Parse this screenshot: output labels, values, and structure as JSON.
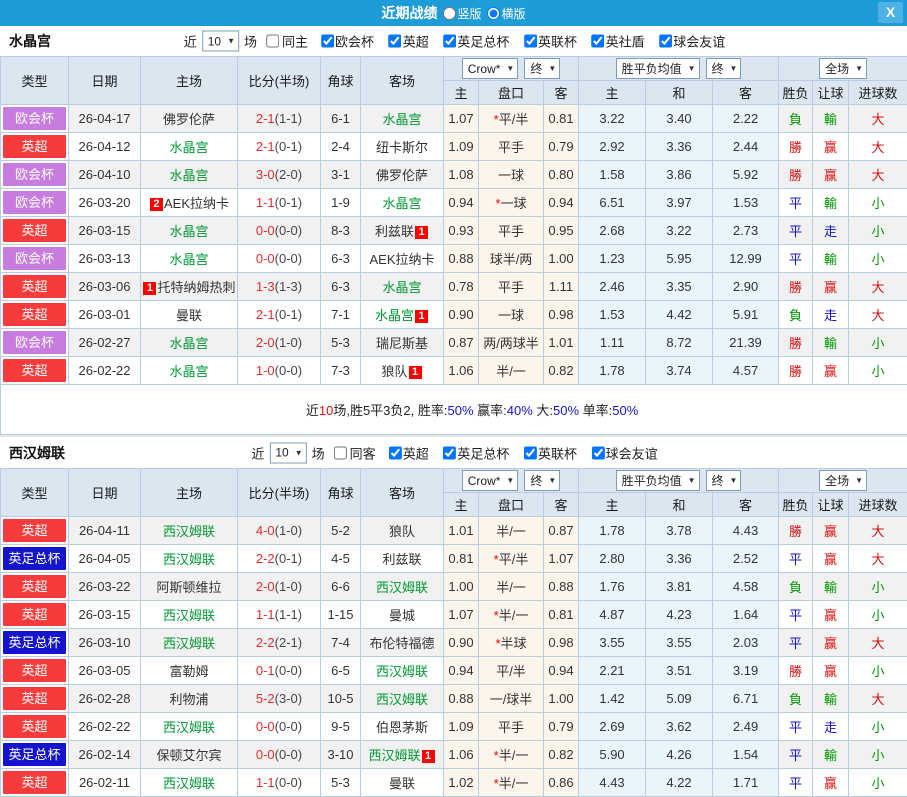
{
  "titlebar": {
    "title": "近期战绩",
    "radios": [
      {
        "label": "竖版",
        "checked": false
      },
      {
        "label": "横版",
        "checked": true
      }
    ],
    "close_label": "X",
    "bar_color": "#1e9cd7"
  },
  "table_header": {
    "type": "类型",
    "date": "日期",
    "home": "主场",
    "score": "比分(半场)",
    "corner": "角球",
    "away": "客场",
    "odds_source_dd": "Crow*",
    "odds_final_dd": "终",
    "avg_dd": "胜平负均值",
    "avg_final_dd": "终",
    "scope_dd": "全场",
    "ah_home": "主",
    "ah_handicap": "盘口",
    "ah_away": "客",
    "eu_home": "主",
    "eu_draw": "和",
    "eu_away": "客",
    "wdl": "胜负",
    "handicap_result": "让球",
    "goals": "进球数"
  },
  "colors": {
    "league_red": "#f53b3b",
    "league_purple": "#c77ce0",
    "league_blue": "#1414cf",
    "win_red": "#dd1111",
    "draw_blue": "#1111cc",
    "lose_green": "#009900",
    "team_green": "#009933"
  },
  "sections": [
    {
      "team": "水晶宫",
      "near_label": "近",
      "count": "10",
      "count_arrow": "▼",
      "matches_label": "场",
      "same": {
        "label": "同主",
        "checked": false
      },
      "comps": [
        {
          "label": "欧会杯",
          "checked": true
        },
        {
          "label": "英超",
          "checked": true
        },
        {
          "label": "英足总杯",
          "checked": true
        },
        {
          "label": "英联杯",
          "checked": true
        },
        {
          "label": "英社盾",
          "checked": true
        },
        {
          "label": "球会友谊",
          "checked": true
        }
      ],
      "rows": [
        {
          "type": "欧会杯",
          "tc": "purple",
          "date": "26-04-17",
          "hb": "",
          "home": "佛罗伦萨",
          "hg": "0",
          "ft": "2-1",
          "ht": "(1-1)",
          "corner": "6-1",
          "away": "水晶宫",
          "ag": "1",
          "ab": "",
          "h": "1.07",
          "star": "*",
          "hcap": "平/半",
          "a": "0.81",
          "o1": "3.22",
          "o2": "3.40",
          "o3": "2.22",
          "wdl": "負",
          "wdlc": "g",
          "let": "輸",
          "letc": "g",
          "ou": "大",
          "ouc": "r"
        },
        {
          "type": "英超",
          "tc": "red",
          "date": "26-04-12",
          "hb": "",
          "home": "水晶宫",
          "hg": "1",
          "ft": "2-1",
          "ht": "(0-1)",
          "corner": "2-4",
          "away": "纽卡斯尔",
          "ag": "0",
          "ab": "",
          "h": "1.09",
          "star": "",
          "hcap": "平手",
          "a": "0.79",
          "o1": "2.92",
          "o2": "3.36",
          "o3": "2.44",
          "wdl": "勝",
          "wdlc": "r",
          "let": "赢",
          "letc": "r",
          "ou": "大",
          "ouc": "r"
        },
        {
          "type": "欧会杯",
          "tc": "purple",
          "date": "26-04-10",
          "hb": "",
          "home": "水晶宫",
          "hg": "1",
          "ft": "3-0",
          "ht": "(2-0)",
          "corner": "3-1",
          "away": "佛罗伦萨",
          "ag": "0",
          "ab": "",
          "h": "1.08",
          "star": "",
          "hcap": "一球",
          "a": "0.80",
          "o1": "1.58",
          "o2": "3.86",
          "o3": "5.92",
          "wdl": "勝",
          "wdlc": "r",
          "let": "赢",
          "letc": "r",
          "ou": "大",
          "ouc": "r"
        },
        {
          "type": "欧会杯",
          "tc": "purple",
          "date": "26-03-20",
          "hb": "2",
          "home": "AEK拉纳卡",
          "hg": "0",
          "ft": "1-1",
          "ht": "(0-1)",
          "corner": "1-9",
          "away": "水晶宫",
          "ag": "1",
          "ab": "",
          "h": "0.94",
          "star": "*",
          "hcap": "一球",
          "a": "0.94",
          "o1": "6.51",
          "o2": "3.97",
          "o3": "1.53",
          "wdl": "平",
          "wdlc": "b",
          "let": "輸",
          "letc": "g",
          "ou": "小",
          "ouc": "g"
        },
        {
          "type": "英超",
          "tc": "red",
          "date": "26-03-15",
          "hb": "",
          "home": "水晶宫",
          "hg": "1",
          "ft": "0-0",
          "ht": "(0-0)",
          "corner": "8-3",
          "away": "利兹联",
          "ag": "0",
          "ab": "1",
          "h": "0.93",
          "star": "",
          "hcap": "平手",
          "a": "0.95",
          "o1": "2.68",
          "o2": "3.22",
          "o3": "2.73",
          "wdl": "平",
          "wdlc": "b",
          "let": "走",
          "letc": "b",
          "ou": "小",
          "ouc": "g"
        },
        {
          "type": "欧会杯",
          "tc": "purple",
          "date": "26-03-13",
          "hb": "",
          "home": "水晶宫",
          "hg": "1",
          "ft": "0-0",
          "ht": "(0-0)",
          "corner": "6-3",
          "away": "AEK拉纳卡",
          "ag": "0",
          "ab": "",
          "h": "0.88",
          "star": "",
          "hcap": "球半/两",
          "a": "1.00",
          "o1": "1.23",
          "o2": "5.95",
          "o3": "12.99",
          "wdl": "平",
          "wdlc": "b",
          "let": "輸",
          "letc": "g",
          "ou": "小",
          "ouc": "g"
        },
        {
          "type": "英超",
          "tc": "red",
          "date": "26-03-06",
          "hb": "1",
          "home": "托特纳姆热刺",
          "hg": "0",
          "ft": "1-3",
          "ht": "(1-3)",
          "corner": "6-3",
          "away": "水晶宫",
          "ag": "1",
          "ab": "",
          "h": "0.78",
          "star": "",
          "hcap": "平手",
          "a": "1.11",
          "o1": "2.46",
          "o2": "3.35",
          "o3": "2.90",
          "wdl": "勝",
          "wdlc": "r",
          "let": "赢",
          "letc": "r",
          "ou": "大",
          "ouc": "r"
        },
        {
          "type": "英超",
          "tc": "red",
          "date": "26-03-01",
          "hb": "",
          "home": "曼联",
          "hg": "0",
          "ft": "2-1",
          "ht": "(0-1)",
          "corner": "7-1",
          "away": "水晶宫",
          "ag": "1",
          "ab": "1",
          "h": "0.90",
          "star": "",
          "hcap": "一球",
          "a": "0.98",
          "o1": "1.53",
          "o2": "4.42",
          "o3": "5.91",
          "wdl": "負",
          "wdlc": "g",
          "let": "走",
          "letc": "b",
          "ou": "大",
          "ouc": "r"
        },
        {
          "type": "欧会杯",
          "tc": "purple",
          "date": "26-02-27",
          "hb": "",
          "home": "水晶宫",
          "hg": "1",
          "ft": "2-0",
          "ht": "(1-0)",
          "corner": "5-3",
          "away": "瑞尼斯基",
          "ag": "0",
          "ab": "",
          "h": "0.87",
          "star": "",
          "hcap": "两/两球半",
          "a": "1.01",
          "o1": "1.11",
          "o2": "8.72",
          "o3": "21.39",
          "wdl": "勝",
          "wdlc": "r",
          "let": "輸",
          "letc": "g",
          "ou": "小",
          "ouc": "g"
        },
        {
          "type": "英超",
          "tc": "red",
          "date": "26-02-22",
          "hb": "",
          "home": "水晶宫",
          "hg": "1",
          "ft": "1-0",
          "ht": "(0-0)",
          "corner": "7-3",
          "away": "狼队",
          "ag": "0",
          "ab": "1",
          "h": "1.06",
          "star": "",
          "hcap": "半/一",
          "a": "0.82",
          "o1": "1.78",
          "o2": "3.74",
          "o3": "4.57",
          "wdl": "勝",
          "wdlc": "r",
          "let": "赢",
          "letc": "r",
          "ou": "小",
          "ouc": "g"
        }
      ],
      "summary": [
        {
          "t": "近",
          "c": "k"
        },
        {
          "t": "10",
          "c": "r"
        },
        {
          "t": "场,胜5平3负2, 胜率:",
          "c": "k"
        },
        {
          "t": "50%",
          "c": "b"
        },
        {
          "t": " 赢率:",
          "c": "k"
        },
        {
          "t": "40%",
          "c": "b"
        },
        {
          "t": " 大:",
          "c": "k"
        },
        {
          "t": "50%",
          "c": "b"
        },
        {
          "t": " 单率:",
          "c": "k"
        },
        {
          "t": "50%",
          "c": "b"
        }
      ]
    },
    {
      "team": "西汉姆联",
      "near_label": "近",
      "count": "10",
      "count_arrow": "▼",
      "matches_label": "场",
      "same": {
        "label": "同客",
        "checked": false
      },
      "comps": [
        {
          "label": "英超",
          "checked": true
        },
        {
          "label": "英足总杯",
          "checked": true
        },
        {
          "label": "英联杯",
          "checked": true
        },
        {
          "label": "球会友谊",
          "checked": true
        }
      ],
      "rows": [
        {
          "type": "英超",
          "tc": "red",
          "date": "26-04-11",
          "hb": "",
          "home": "西汉姆联",
          "hg": "1",
          "ft": "4-0",
          "ht": "(1-0)",
          "corner": "5-2",
          "away": "狼队",
          "ag": "0",
          "ab": "",
          "h": "1.01",
          "star": "",
          "hcap": "半/一",
          "a": "0.87",
          "o1": "1.78",
          "o2": "3.78",
          "o3": "4.43",
          "wdl": "勝",
          "wdlc": "r",
          "let": "赢",
          "letc": "r",
          "ou": "大",
          "ouc": "r"
        },
        {
          "type": "英足总杯",
          "tc": "blue",
          "date": "26-04-05",
          "hb": "",
          "home": "西汉姆联",
          "hg": "1",
          "ft": "2-2",
          "ht": "(0-1)",
          "corner": "4-5",
          "away": "利兹联",
          "ag": "0",
          "ab": "",
          "h": "0.81",
          "star": "*",
          "hcap": "平/半",
          "a": "1.07",
          "o1": "2.80",
          "o2": "3.36",
          "o3": "2.52",
          "wdl": "平",
          "wdlc": "b",
          "let": "赢",
          "letc": "r",
          "ou": "大",
          "ouc": "r"
        },
        {
          "type": "英超",
          "tc": "red",
          "date": "26-03-22",
          "hb": "",
          "home": "阿斯顿维拉",
          "hg": "0",
          "ft": "2-0",
          "ht": "(1-0)",
          "corner": "6-6",
          "away": "西汉姆联",
          "ag": "1",
          "ab": "",
          "h": "1.00",
          "star": "",
          "hcap": "半/一",
          "a": "0.88",
          "o1": "1.76",
          "o2": "3.81",
          "o3": "4.58",
          "wdl": "負",
          "wdlc": "g",
          "let": "輸",
          "letc": "g",
          "ou": "小",
          "ouc": "g"
        },
        {
          "type": "英超",
          "tc": "red",
          "date": "26-03-15",
          "hb": "",
          "home": "西汉姆联",
          "hg": "1",
          "ft": "1-1",
          "ht": "(1-1)",
          "corner": "1-15",
          "away": "曼城",
          "ag": "0",
          "ab": "",
          "h": "1.07",
          "star": "*",
          "hcap": "半/一",
          "a": "0.81",
          "o1": "4.87",
          "o2": "4.23",
          "o3": "1.64",
          "wdl": "平",
          "wdlc": "b",
          "let": "赢",
          "letc": "r",
          "ou": "小",
          "ouc": "g"
        },
        {
          "type": "英足总杯",
          "tc": "blue",
          "date": "26-03-10",
          "hb": "",
          "home": "西汉姆联",
          "hg": "1",
          "ft": "2-2",
          "ht": "(2-1)",
          "corner": "7-4",
          "away": "布伦特福德",
          "ag": "0",
          "ab": "",
          "h": "0.90",
          "star": "*",
          "hcap": "半球",
          "a": "0.98",
          "o1": "3.55",
          "o2": "3.55",
          "o3": "2.03",
          "wdl": "平",
          "wdlc": "b",
          "let": "赢",
          "letc": "r",
          "ou": "大",
          "ouc": "r"
        },
        {
          "type": "英超",
          "tc": "red",
          "date": "26-03-05",
          "hb": "",
          "home": "富勒姆",
          "hg": "0",
          "ft": "0-1",
          "ht": "(0-0)",
          "corner": "6-5",
          "away": "西汉姆联",
          "ag": "1",
          "ab": "",
          "h": "0.94",
          "star": "",
          "hcap": "平/半",
          "a": "0.94",
          "o1": "2.21",
          "o2": "3.51",
          "o3": "3.19",
          "wdl": "勝",
          "wdlc": "r",
          "let": "赢",
          "letc": "r",
          "ou": "小",
          "ouc": "g"
        },
        {
          "type": "英超",
          "tc": "red",
          "date": "26-02-28",
          "hb": "",
          "home": "利物浦",
          "hg": "0",
          "ft": "5-2",
          "ht": "(3-0)",
          "corner": "10-5",
          "away": "西汉姆联",
          "ag": "1",
          "ab": "",
          "h": "0.88",
          "star": "",
          "hcap": "一/球半",
          "a": "1.00",
          "o1": "1.42",
          "o2": "5.09",
          "o3": "6.71",
          "wdl": "負",
          "wdlc": "g",
          "let": "輸",
          "letc": "g",
          "ou": "大",
          "ouc": "r"
        },
        {
          "type": "英超",
          "tc": "red",
          "date": "26-02-22",
          "hb": "",
          "home": "西汉姆联",
          "hg": "1",
          "ft": "0-0",
          "ht": "(0-0)",
          "corner": "9-5",
          "away": "伯恩茅斯",
          "ag": "0",
          "ab": "",
          "h": "1.09",
          "star": "",
          "hcap": "平手",
          "a": "0.79",
          "o1": "2.69",
          "o2": "3.62",
          "o3": "2.49",
          "wdl": "平",
          "wdlc": "b",
          "let": "走",
          "letc": "b",
          "ou": "小",
          "ouc": "g"
        },
        {
          "type": "英足总杯",
          "tc": "blue",
          "date": "26-02-14",
          "hb": "",
          "home": "保顿艾尔宾",
          "hg": "0",
          "ft": "0-0",
          "ht": "(0-0)",
          "corner": "3-10",
          "away": "西汉姆联",
          "ag": "1",
          "ab": "1",
          "h": "1.06",
          "star": "*",
          "hcap": "半/一",
          "a": "0.82",
          "o1": "5.90",
          "o2": "4.26",
          "o3": "1.54",
          "wdl": "平",
          "wdlc": "b",
          "let": "輸",
          "letc": "g",
          "ou": "小",
          "ouc": "g"
        },
        {
          "type": "英超",
          "tc": "red",
          "date": "26-02-11",
          "hb": "",
          "home": "西汉姆联",
          "hg": "1",
          "ft": "1-1",
          "ht": "(0-0)",
          "corner": "5-3",
          "away": "曼联",
          "ag": "0",
          "ab": "",
          "h": "1.02",
          "star": "*",
          "hcap": "半/一",
          "a": "0.86",
          "o1": "4.43",
          "o2": "4.22",
          "o3": "1.71",
          "wdl": "平",
          "wdlc": "b",
          "let": "赢",
          "letc": "r",
          "ou": "小",
          "ouc": "g"
        }
      ]
    }
  ]
}
